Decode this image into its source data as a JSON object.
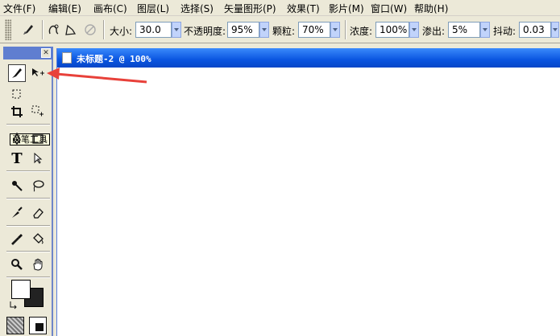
{
  "menubar": {
    "items": [
      "文件(F)",
      "编辑(E)",
      "画布(C)",
      "图层(L)",
      "选择(S)",
      "矢量图形(P)",
      "效果(T)",
      "影片(M)",
      "窗口(W)",
      "帮助(H)"
    ]
  },
  "options": {
    "size_label": "大小:",
    "size_value": "30.0",
    "opacity_label": "不透明度:",
    "opacity_value": "95%",
    "grain_label": "颗粒:",
    "grain_value": "70%",
    "density_label": "浓度:",
    "density_value": "100%",
    "bleed_label": "渗出:",
    "bleed_value": "5%",
    "jitter_label": "抖动:",
    "jitter_value": "0.03"
  },
  "toolbox": {
    "close_glyph": "✕",
    "tooltip": "画笔工具",
    "type_tool_glyph": "T"
  },
  "document": {
    "title": "未标题-2 @ 100%"
  },
  "colors": {
    "accent": "#0a55e0",
    "arrow": "#e8413a"
  }
}
